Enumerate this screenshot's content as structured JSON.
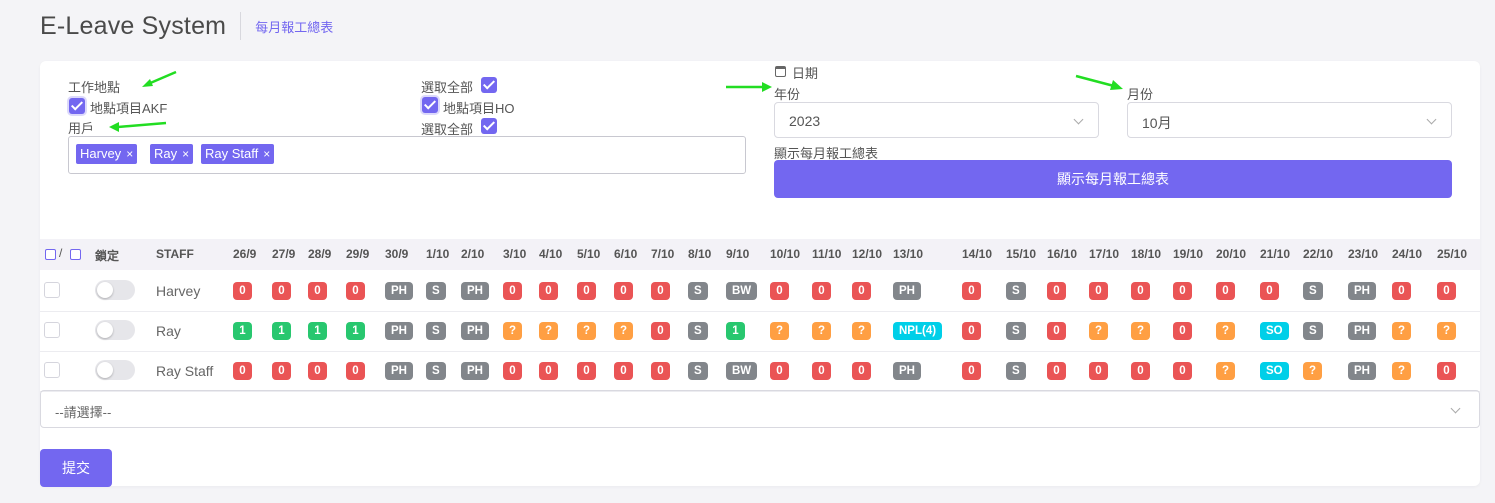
{
  "header": {
    "app_title": "E-Leave System",
    "breadcrumb": "每月報工總表"
  },
  "filters": {
    "location_label": "工作地點",
    "select_all_label_1": "選取全部",
    "location_akf": "地點項目AKF",
    "location_ho": "地點項目HO",
    "select_all_label_2": "選取全部",
    "user_label": "用戶",
    "selected_users": [
      "Harvey",
      "Ray",
      "Ray Staff"
    ],
    "remove_symbol": "×",
    "date_label": "日期",
    "year_label": "年份",
    "year_value": "2023",
    "month_label": "月份",
    "month_value": "10月",
    "show_label": "顯示每月報工總表",
    "show_button": "顯示每月報工總表"
  },
  "table": {
    "select_slash": "/",
    "lock_header": "鎖定",
    "staff_header": "STAFF",
    "dates": [
      "26/9",
      "27/9",
      "28/9",
      "29/9",
      "30/9",
      "1/10",
      "2/10",
      "3/10",
      "4/10",
      "5/10",
      "6/10",
      "7/10",
      "8/10",
      "9/10",
      "10/10",
      "11/10",
      "12/10",
      "13/10",
      "14/10",
      "15/10",
      "16/10",
      "17/10",
      "18/10",
      "19/10",
      "20/10",
      "21/10",
      "22/10",
      "23/10",
      "24/10",
      "25/10"
    ],
    "rows": [
      {
        "staff": "Harvey",
        "cells": [
          {
            "t": "0",
            "c": "red"
          },
          {
            "t": "0",
            "c": "red"
          },
          {
            "t": "0",
            "c": "red"
          },
          {
            "t": "0",
            "c": "red"
          },
          {
            "t": "PH",
            "c": "grey"
          },
          {
            "t": "S",
            "c": "grey"
          },
          {
            "t": "PH",
            "c": "grey"
          },
          {
            "t": "0",
            "c": "red"
          },
          {
            "t": "0",
            "c": "red"
          },
          {
            "t": "0",
            "c": "red"
          },
          {
            "t": "0",
            "c": "red"
          },
          {
            "t": "0",
            "c": "red"
          },
          {
            "t": "S",
            "c": "grey"
          },
          {
            "t": "BW",
            "c": "grey"
          },
          {
            "t": "0",
            "c": "red"
          },
          {
            "t": "0",
            "c": "red"
          },
          {
            "t": "0",
            "c": "red"
          },
          {
            "t": "PH",
            "c": "grey"
          },
          {
            "t": "0",
            "c": "red"
          },
          {
            "t": "S",
            "c": "grey"
          },
          {
            "t": "0",
            "c": "red"
          },
          {
            "t": "0",
            "c": "red"
          },
          {
            "t": "0",
            "c": "red"
          },
          {
            "t": "0",
            "c": "red"
          },
          {
            "t": "0",
            "c": "red"
          },
          {
            "t": "0",
            "c": "red"
          },
          {
            "t": "S",
            "c": "grey"
          },
          {
            "t": "PH",
            "c": "grey"
          },
          {
            "t": "0",
            "c": "red"
          },
          {
            "t": "0",
            "c": "red"
          }
        ]
      },
      {
        "staff": "Ray",
        "cells": [
          {
            "t": "1",
            "c": "green"
          },
          {
            "t": "1",
            "c": "green"
          },
          {
            "t": "1",
            "c": "green"
          },
          {
            "t": "1",
            "c": "green"
          },
          {
            "t": "PH",
            "c": "grey"
          },
          {
            "t": "S",
            "c": "grey"
          },
          {
            "t": "PH",
            "c": "grey"
          },
          {
            "t": "?",
            "c": "orange"
          },
          {
            "t": "?",
            "c": "orange"
          },
          {
            "t": "?",
            "c": "orange"
          },
          {
            "t": "?",
            "c": "orange"
          },
          {
            "t": "0",
            "c": "red"
          },
          {
            "t": "S",
            "c": "grey"
          },
          {
            "t": "1",
            "c": "green"
          },
          {
            "t": "?",
            "c": "orange"
          },
          {
            "t": "?",
            "c": "orange"
          },
          {
            "t": "?",
            "c": "orange"
          },
          {
            "t": "NPL(4)",
            "c": "cyan"
          },
          {
            "t": "0",
            "c": "red"
          },
          {
            "t": "S",
            "c": "grey"
          },
          {
            "t": "0",
            "c": "red"
          },
          {
            "t": "?",
            "c": "orange"
          },
          {
            "t": "?",
            "c": "orange"
          },
          {
            "t": "0",
            "c": "red"
          },
          {
            "t": "?",
            "c": "orange"
          },
          {
            "t": "SO",
            "c": "cyan"
          },
          {
            "t": "S",
            "c": "grey"
          },
          {
            "t": "PH",
            "c": "grey"
          },
          {
            "t": "?",
            "c": "orange"
          },
          {
            "t": "?",
            "c": "orange"
          }
        ]
      },
      {
        "staff": "Ray Staff",
        "cells": [
          {
            "t": "0",
            "c": "red"
          },
          {
            "t": "0",
            "c": "red"
          },
          {
            "t": "0",
            "c": "red"
          },
          {
            "t": "0",
            "c": "red"
          },
          {
            "t": "PH",
            "c": "grey"
          },
          {
            "t": "S",
            "c": "grey"
          },
          {
            "t": "PH",
            "c": "grey"
          },
          {
            "t": "0",
            "c": "red"
          },
          {
            "t": "0",
            "c": "red"
          },
          {
            "t": "0",
            "c": "red"
          },
          {
            "t": "0",
            "c": "red"
          },
          {
            "t": "0",
            "c": "red"
          },
          {
            "t": "S",
            "c": "grey"
          },
          {
            "t": "BW",
            "c": "grey"
          },
          {
            "t": "0",
            "c": "red"
          },
          {
            "t": "0",
            "c": "red"
          },
          {
            "t": "0",
            "c": "red"
          },
          {
            "t": "PH",
            "c": "grey"
          },
          {
            "t": "0",
            "c": "red"
          },
          {
            "t": "S",
            "c": "grey"
          },
          {
            "t": "0",
            "c": "red"
          },
          {
            "t": "0",
            "c": "red"
          },
          {
            "t": "0",
            "c": "red"
          },
          {
            "t": "0",
            "c": "red"
          },
          {
            "t": "?",
            "c": "orange"
          },
          {
            "t": "SO",
            "c": "cyan"
          },
          {
            "t": "?",
            "c": "orange"
          },
          {
            "t": "PH",
            "c": "grey"
          },
          {
            "t": "?",
            "c": "orange"
          },
          {
            "t": "0",
            "c": "red"
          }
        ]
      }
    ]
  },
  "bottom_select": {
    "value": "--請選擇--"
  },
  "submit_button": "提交",
  "colors": {
    "accent": "#7367f0",
    "red": "#ea5455",
    "grey": "#82868b",
    "green": "#28c76f",
    "orange": "#ff9f43",
    "cyan": "#00cfe8",
    "annotation_arrow": "#22dd22"
  }
}
